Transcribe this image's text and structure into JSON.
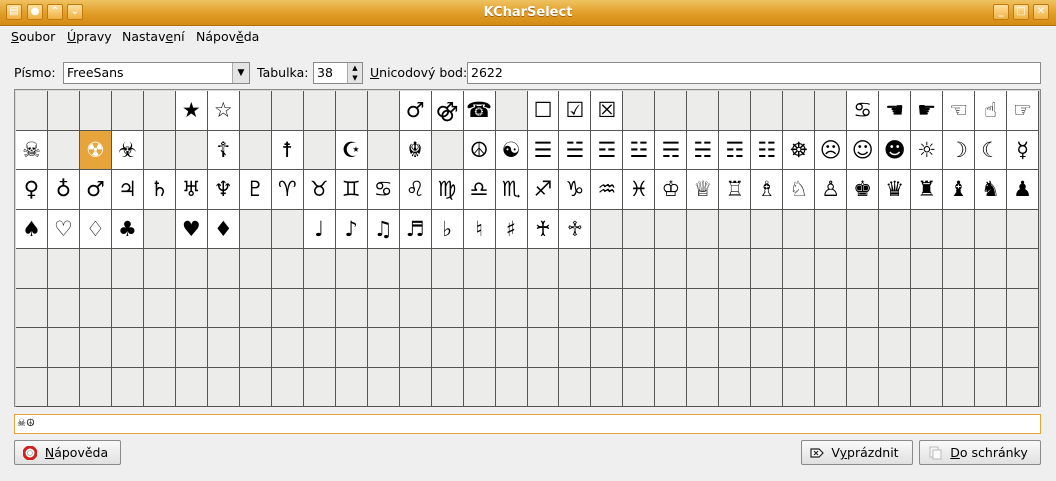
{
  "window": {
    "title": "KCharSelect",
    "left_buttons": [
      "window-menu-icon",
      "sticky-icon",
      "shade-up-icon",
      "shade-down-icon"
    ],
    "right_buttons": [
      "minimize-icon",
      "maximize-icon",
      "close-icon"
    ]
  },
  "menubar": {
    "items": [
      {
        "accel": "S",
        "rest": "oubor"
      },
      {
        "accel": "Ú",
        "rest": "pravy"
      },
      {
        "pre": "Nastav",
        "accel": "e",
        "rest": "ní"
      },
      {
        "pre": "Nápov",
        "accel": "ě",
        "rest": "da"
      }
    ]
  },
  "toolbar": {
    "font_label": "Písmo:",
    "font_value": "FreeSans",
    "table_label": "Tabulka:",
    "table_value": "38",
    "unicode_label_accel": "U",
    "unicode_label_rest": "nicodový bod:",
    "unicode_value": "2622"
  },
  "grid": {
    "columns": 32,
    "rows": [
      [
        "",
        "",
        "",
        "",
        "",
        "★",
        "☆",
        "",
        "",
        "",
        "",
        "",
        "♂",
        "⚣",
        "☎",
        "",
        "☐",
        "☑",
        "☒",
        "",
        "",
        "",
        "",
        "",
        "",
        "",
        "♋",
        "☚",
        "☛",
        "☜",
        "☝",
        "☞",
        "☟"
      ],
      [
        "☠",
        "",
        "☢",
        "☣",
        "",
        "",
        "☦",
        "",
        "☨",
        "",
        "☪",
        "",
        "☬",
        "",
        "☮",
        "☯",
        "☰",
        "☱",
        "☲",
        "☳",
        "☴",
        "☵",
        "☶",
        "☷",
        "☸",
        "☹",
        "☺",
        "☻",
        "☼",
        "☽",
        "☾",
        "☿"
      ],
      [
        "♀",
        "♁",
        "♂",
        "♃",
        "♄",
        "♅",
        "♆",
        "♇",
        "♈",
        "♉",
        "♊",
        "♋",
        "♌",
        "♍",
        "♎",
        "♏",
        "♐",
        "♑",
        "♒",
        "♓",
        "♔",
        "♕",
        "♖",
        "♗",
        "♘",
        "♙",
        "♚",
        "♛",
        "♜",
        "♝",
        "♞",
        "♟"
      ],
      [
        "♠",
        "♡",
        "♢",
        "♣",
        "",
        "♥",
        "♦",
        "",
        "",
        "♩",
        "♪",
        "♫",
        "♬",
        "♭",
        "♮",
        "♯",
        "♰",
        "♱",
        "",
        "",
        "",
        "",
        "",
        "",
        "",
        "",
        "",
        "",
        "",
        "",
        "",
        ""
      ],
      [
        "",
        "",
        "",
        "",
        "",
        "",
        "",
        "",
        "",
        "",
        "",
        "",
        "",
        "",
        "",
        "",
        "",
        "",
        "",
        "",
        "",
        "",
        "",
        "",
        "",
        "",
        "",
        "",
        "",
        "",
        "",
        ""
      ],
      [
        "",
        "",
        "",
        "",
        "",
        "",
        "",
        "",
        "",
        "",
        "",
        "",
        "",
        "",
        "",
        "",
        "",
        "",
        "",
        "",
        "",
        "",
        "",
        "",
        "",
        "",
        "",
        "",
        "",
        "",
        "",
        ""
      ],
      [
        "",
        "",
        "",
        "",
        "",
        "",
        "",
        "",
        "",
        "",
        "",
        "",
        "",
        "",
        "",
        "",
        "",
        "",
        "",
        "",
        "",
        "",
        "",
        "",
        "",
        "",
        "",
        "",
        "",
        "",
        "",
        ""
      ],
      [
        "",
        "",
        "",
        "",
        "",
        "",
        "",
        "",
        "",
        "",
        "",
        "",
        "",
        "",
        "",
        "",
        "",
        "",
        "",
        "",
        "",
        "",
        "",
        "",
        "",
        "",
        "",
        "",
        "",
        "",
        "",
        ""
      ]
    ],
    "selected": [
      1,
      2
    ]
  },
  "clipboard_strip": "☠☮",
  "buttons": {
    "help_accel": "N",
    "help_rest": "ápověda",
    "clear_pre": "V",
    "clear_accel": "y",
    "clear_rest": "prázdnit",
    "copy_accel": "D",
    "copy_rest": "o schránky"
  }
}
